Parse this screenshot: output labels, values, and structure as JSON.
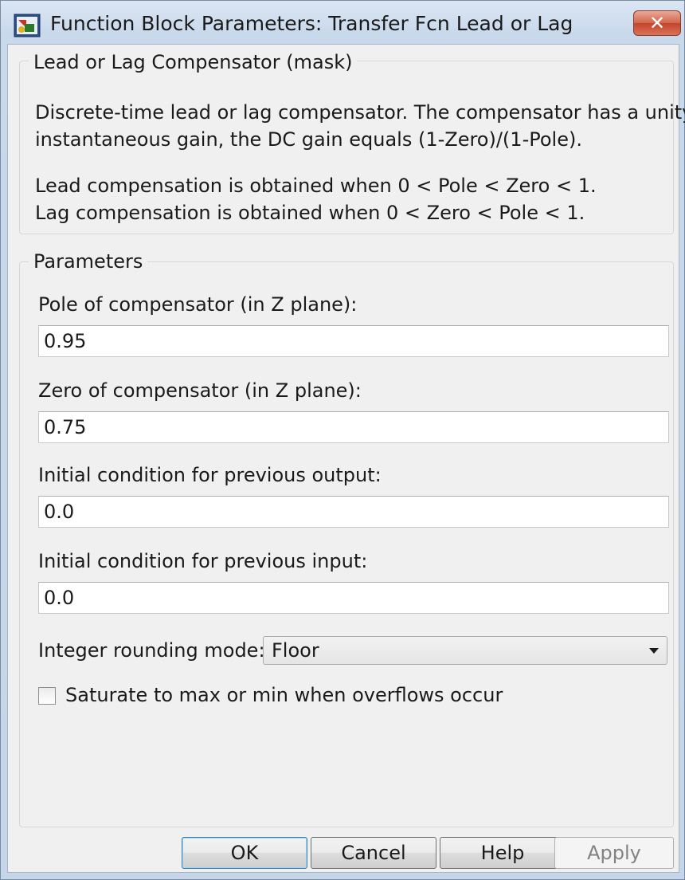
{
  "window": {
    "title": "Function Block Parameters: Transfer Fcn Lead or Lag",
    "close_label": "✕"
  },
  "mask": {
    "legend": "Lead or Lag Compensator (mask)",
    "description": [
      "Discrete-time lead or lag compensator.  The compensator has a unity",
      "instantaneous gain, the DC gain equals (1-Zero)/(1-Pole).",
      "Lead compensation is obtained when 0 < Pole < Zero < 1.",
      "Lag compensation is obtained when 0 < Zero < Pole < 1."
    ]
  },
  "parameters": {
    "legend": "Parameters",
    "pole": {
      "label": "Pole of compensator (in Z plane):",
      "value": "0.95"
    },
    "zero": {
      "label": "Zero of compensator (in Z plane):",
      "value": "0.75"
    },
    "ic_output": {
      "label": "Initial condition for previous output:",
      "value": "0.0"
    },
    "ic_input": {
      "label": "Initial condition for previous input:",
      "value": "0.0"
    },
    "rounding": {
      "label": "Integer rounding mode:",
      "value": "Floor"
    },
    "saturate": {
      "label": "Saturate to max or min when overflows occur",
      "checked": false
    }
  },
  "buttons": {
    "ok": "OK",
    "cancel": "Cancel",
    "help": "Help",
    "apply": "Apply"
  },
  "icons": {
    "app": "simulink-block-icon",
    "close": "close-icon",
    "dropdown": "chevron-down-icon"
  },
  "colors": {
    "titlebar": "#c9d9ec",
    "close_button": "#c2452a",
    "default_button_border": "#3c7fb1"
  }
}
